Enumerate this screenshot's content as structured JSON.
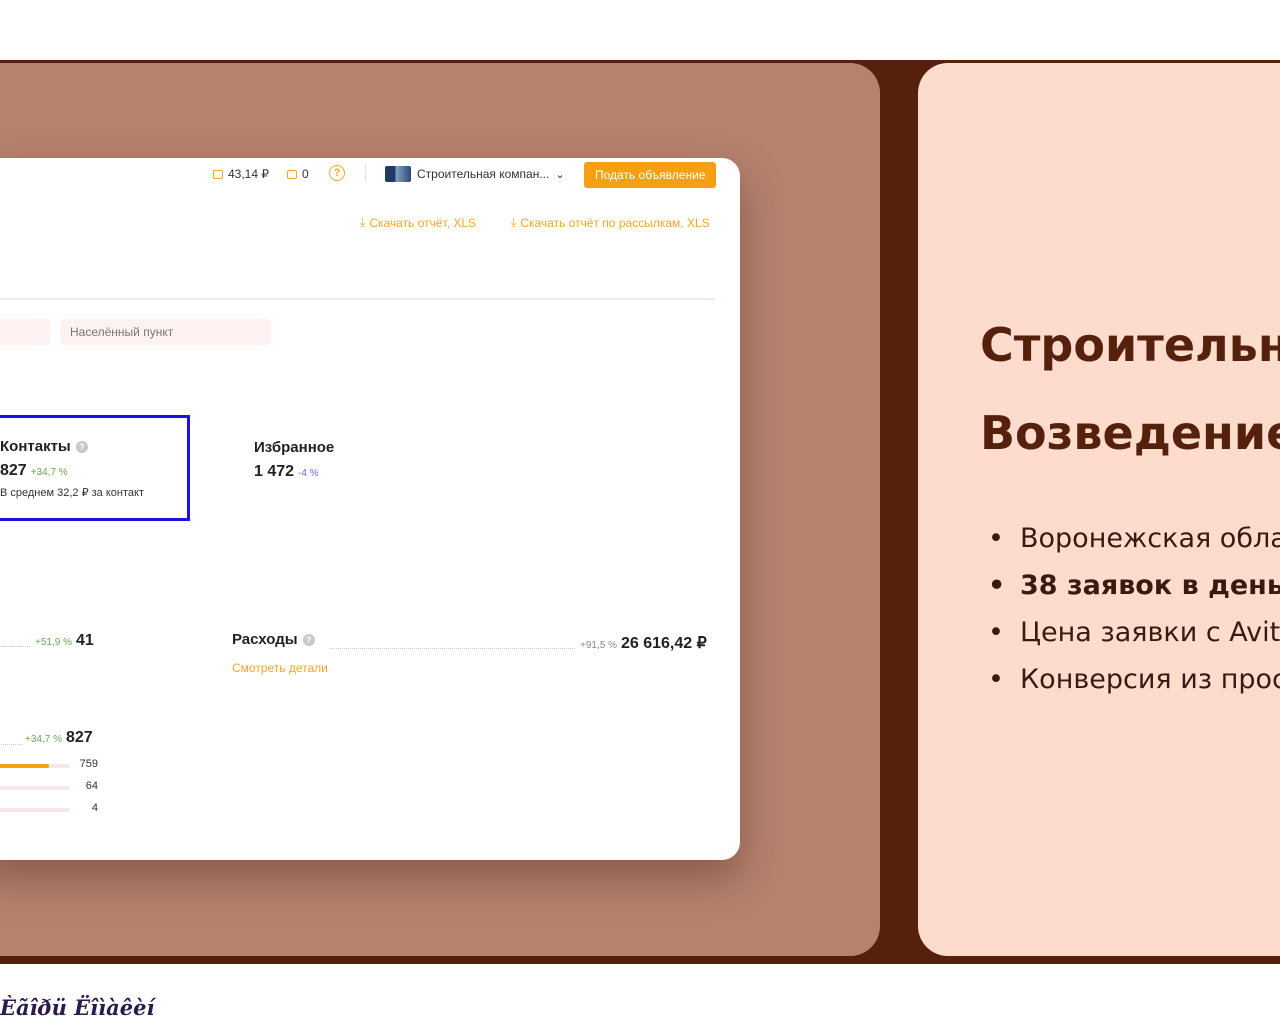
{
  "screenshot": {
    "topbar": {
      "wallet_amount": "43,14 ₽",
      "bonus_count": "0",
      "help_symbol": "?",
      "company_name": "Строительная компан...",
      "company_chevron": "⌄",
      "post_button": "Подать объявление"
    },
    "downloads": {
      "report_xls": "Скачать отчёт, XLS",
      "mailing_report_xls": "Скачать отчёт по рассылкам, XLS",
      "download_icon": "download-icon"
    },
    "filters": {
      "locality_placeholder": "Населённый пункт"
    },
    "metrics": {
      "contacts": {
        "title": "Контакты",
        "value": "827",
        "change": "+34,7 %",
        "note": "В среднем 32,2 ₽ за контакт"
      },
      "favorites": {
        "title": "Избранное",
        "value": "1 472",
        "change": "-4 %"
      }
    },
    "summary": {
      "row1": {
        "change": "+51,9 %",
        "value": "41"
      },
      "expenses": {
        "title": "Расходы",
        "change": "+91,5 %",
        "value": "26 616,42 ₽",
        "details_link": "Смотреть детали"
      },
      "row2": {
        "change": "+34,7 %",
        "value": "827"
      },
      "breakdown": [
        {
          "value": "759",
          "fraction": 0.917
        },
        {
          "value": "64",
          "fraction": 0.077
        },
        {
          "value": "4",
          "fraction": 0.005
        }
      ]
    }
  },
  "slide": {
    "heading_line1": "Строительн",
    "heading_line2": "Возведение",
    "bullets": [
      {
        "text": "Воронежская обла",
        "bold": false
      },
      {
        "text": "38 заявок в день",
        "bold": true
      },
      {
        "text": "Цена заявки с Avit",
        "bold": false
      },
      {
        "text": "Конверсия из прос",
        "bold": false
      }
    ]
  },
  "footer_text": "Èãîðü Ëîìàêèí",
  "colors": {
    "dark_brown": "#55210d",
    "panel_brown": "#b4826d",
    "peach": "#fddcce",
    "accent_orange": "#f5a011",
    "highlight_blue": "#1b13e0"
  }
}
